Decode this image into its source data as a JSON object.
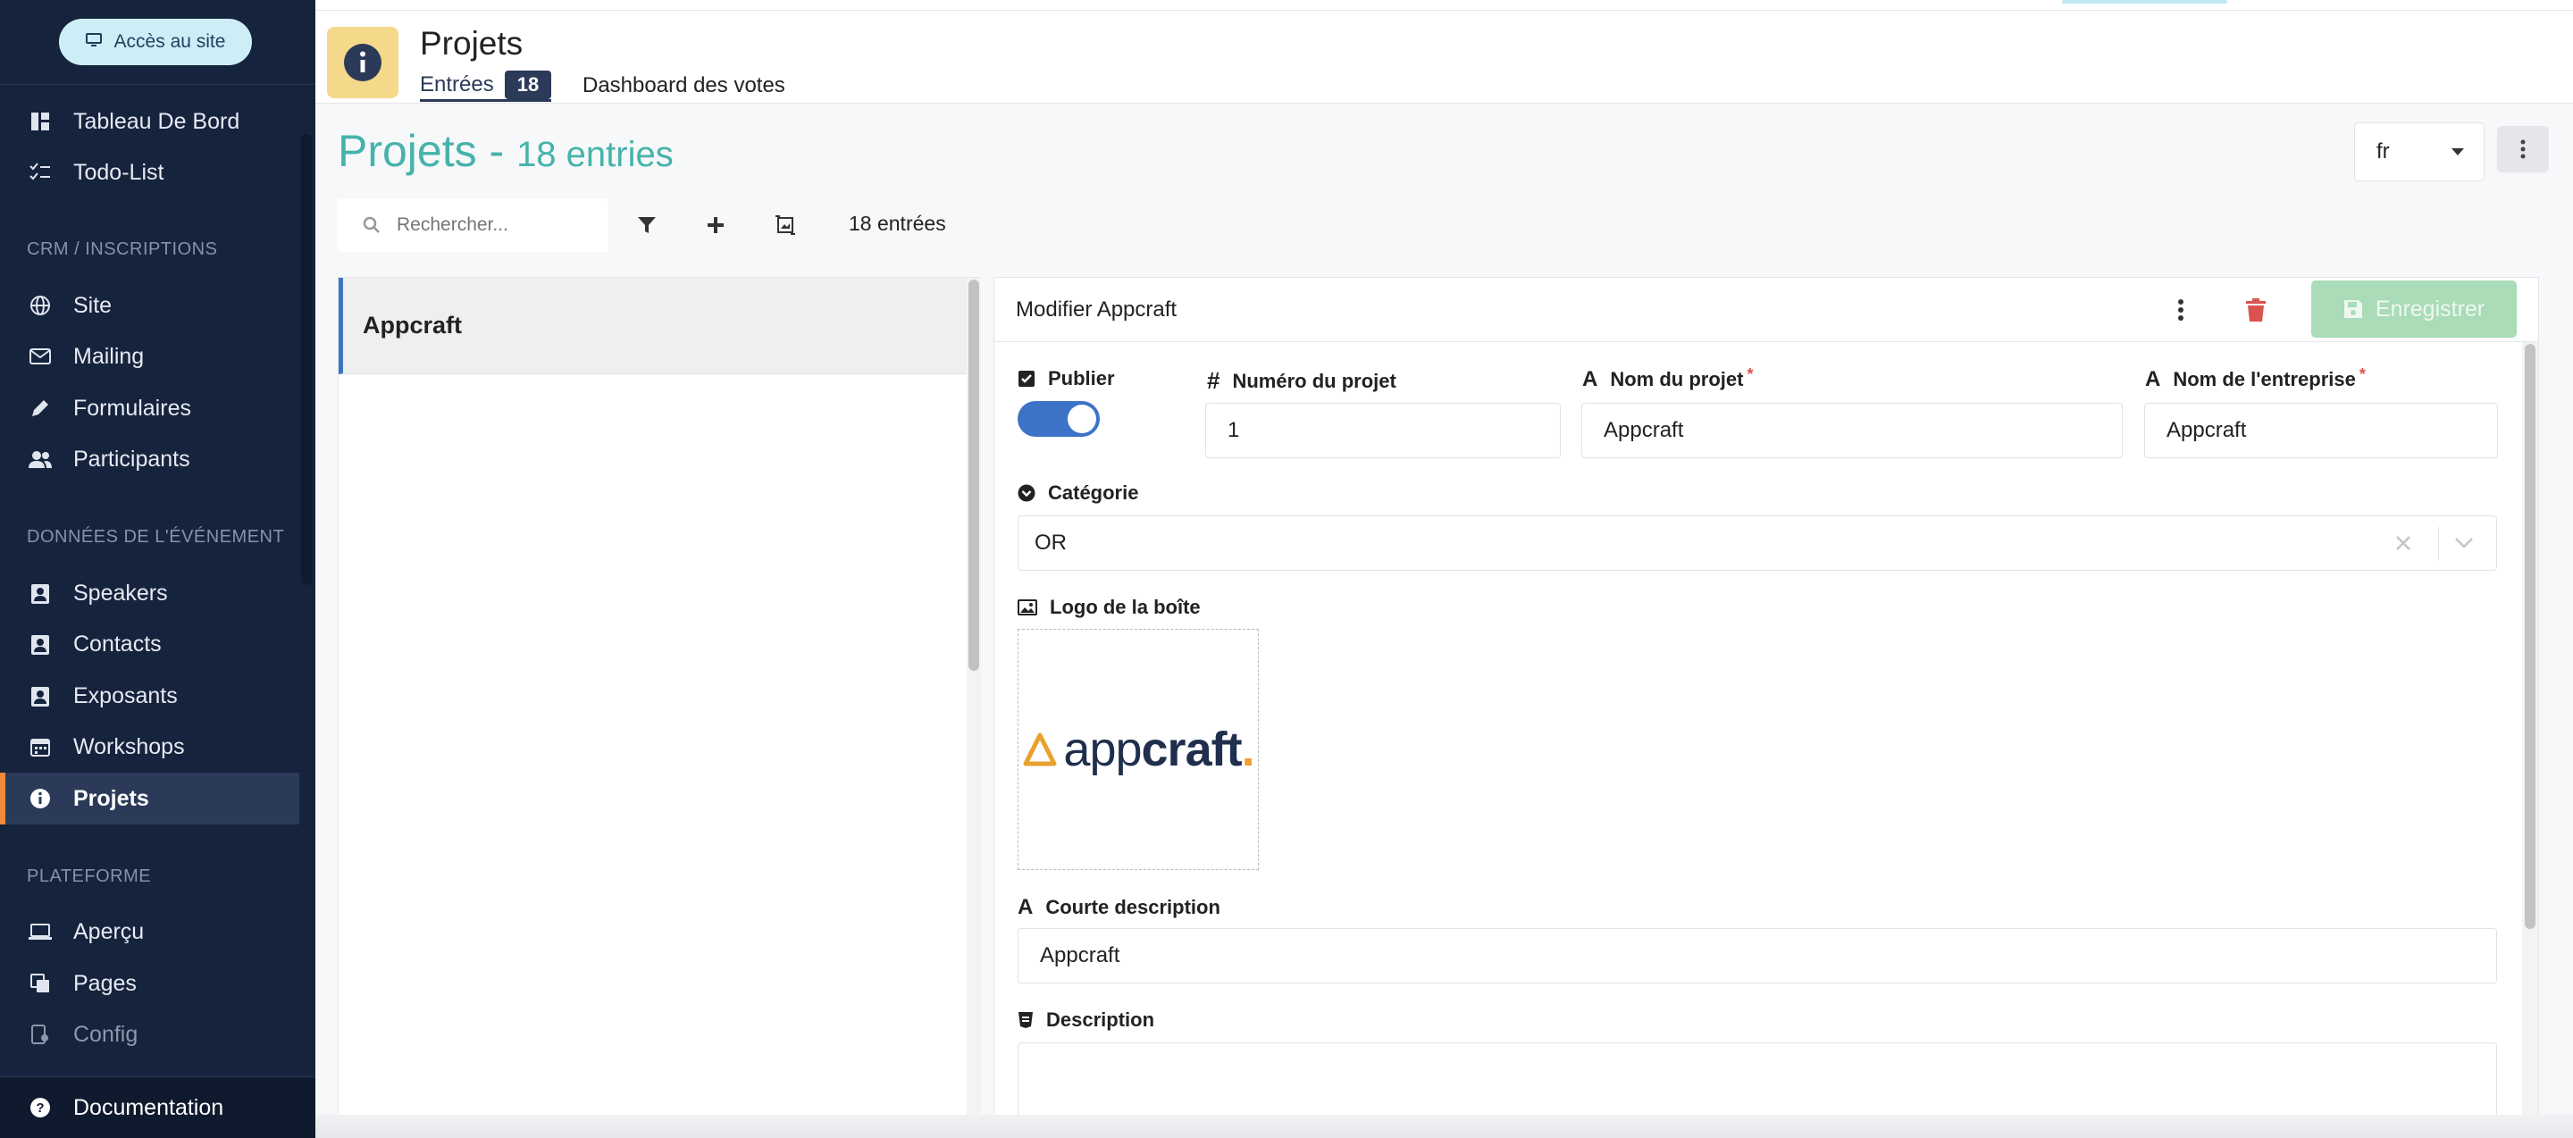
{
  "sidebar": {
    "site_button": "Accès au site",
    "sections": {
      "crm": "CRM / INSCRIPTIONS",
      "event": "DONNÉES DE L'ÉVÉNEMENT",
      "platform": "PLATEFORME"
    },
    "items": [
      {
        "label": "Tableau De Bord",
        "icon": "dashboard-icon"
      },
      {
        "label": "Todo-List",
        "icon": "checklist-icon"
      },
      {
        "label": "Site",
        "icon": "globe-icon"
      },
      {
        "label": "Mailing",
        "icon": "mail-icon"
      },
      {
        "label": "Formulaires",
        "icon": "pencil-icon"
      },
      {
        "label": "Participants",
        "icon": "users-icon"
      },
      {
        "label": "Speakers",
        "icon": "contact-card-icon"
      },
      {
        "label": "Contacts",
        "icon": "contact-card-icon"
      },
      {
        "label": "Exposants",
        "icon": "contact-card-icon"
      },
      {
        "label": "Workshops",
        "icon": "calendar-icon"
      },
      {
        "label": "Projets",
        "icon": "info-icon",
        "active": true
      },
      {
        "label": "Aperçu",
        "icon": "laptop-icon"
      },
      {
        "label": "Pages",
        "icon": "pages-icon"
      },
      {
        "label": "Config",
        "icon": "config-icon"
      }
    ],
    "documentation": "Documentation"
  },
  "header": {
    "title": "Projets",
    "tabs": [
      {
        "label": "Entrées",
        "badge": "18"
      },
      {
        "label": "Dashboard des votes"
      }
    ]
  },
  "page": {
    "title": "Projets - ",
    "subtitle": "18 entries",
    "language": "fr"
  },
  "toolbar": {
    "search_placeholder": "Rechercher...",
    "count_label": "18 entrées"
  },
  "list": {
    "items": [
      "Appcraft"
    ]
  },
  "editor": {
    "title": "Modifier Appcraft",
    "save_label": "Enregistrer",
    "fields": {
      "publish": {
        "label": "Publier",
        "value": true
      },
      "project_number": {
        "label": "Numéro du projet",
        "value": "1"
      },
      "project_name": {
        "label": "Nom du projet",
        "value": "Appcraft",
        "required": "*"
      },
      "company_name": {
        "label": "Nom de l'entreprise",
        "value": "Appcraft",
        "required": "*"
      },
      "category": {
        "label": "Catégorie",
        "value": "OR"
      },
      "logo": {
        "label": "Logo de la boîte",
        "logo_text_light": "app",
        "logo_text_bold": "craft",
        "logo_dot": "."
      },
      "short_description": {
        "label": "Courte description",
        "value": "Appcraft"
      },
      "description": {
        "label": "Description",
        "value": ""
      }
    }
  },
  "colors": {
    "sidebar_bg": "#16233d",
    "accent_teal": "#45b3aa",
    "active_marker": "#f08a3b",
    "primary_blue": "#3d73c6",
    "save_green": "#a9dcb7",
    "delete_red": "#d9534f"
  }
}
